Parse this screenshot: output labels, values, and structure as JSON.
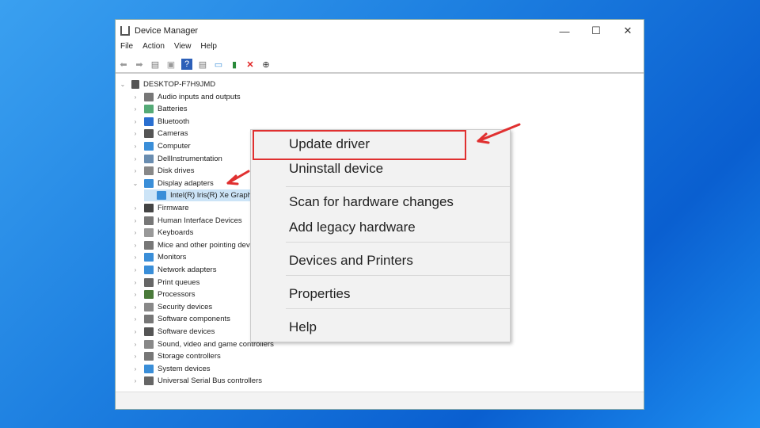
{
  "window": {
    "title": "Device Manager",
    "minimize": "—",
    "maximize": "☐",
    "close": "✕"
  },
  "menu": [
    "File",
    "Action",
    "View",
    "Help"
  ],
  "toolbar_icons": [
    "back-icon",
    "forward-icon",
    "properties-icon",
    "update-icon",
    "help-icon",
    "view-icon",
    "monitor-icon",
    "enable-device-icon",
    "uninstall-icon",
    "download-icon"
  ],
  "tree": {
    "root": "DESKTOP-F7H9JMD",
    "items": [
      "Audio inputs and outputs",
      "Batteries",
      "Bluetooth",
      "Cameras",
      "Computer",
      "DellInstrumentation",
      "Disk drives",
      "Display adapters",
      "Intel(R) Iris(R) Xe Graphics",
      "Firmware",
      "Human Interface Devices",
      "Keyboards",
      "Mice and other pointing devices",
      "Monitors",
      "Network adapters",
      "Print queues",
      "Processors",
      "Security devices",
      "Software components",
      "Software devices",
      "Sound, video and game controllers",
      "Storage controllers",
      "System devices",
      "Universal Serial Bus controllers"
    ]
  },
  "context_menu": [
    "Update driver",
    "Uninstall device",
    "Scan for hardware changes",
    "Add legacy hardware",
    "Devices and Printers",
    "Properties",
    "Help"
  ],
  "colors": {
    "highlight": "#e03030",
    "selection": "#cce4f7"
  }
}
